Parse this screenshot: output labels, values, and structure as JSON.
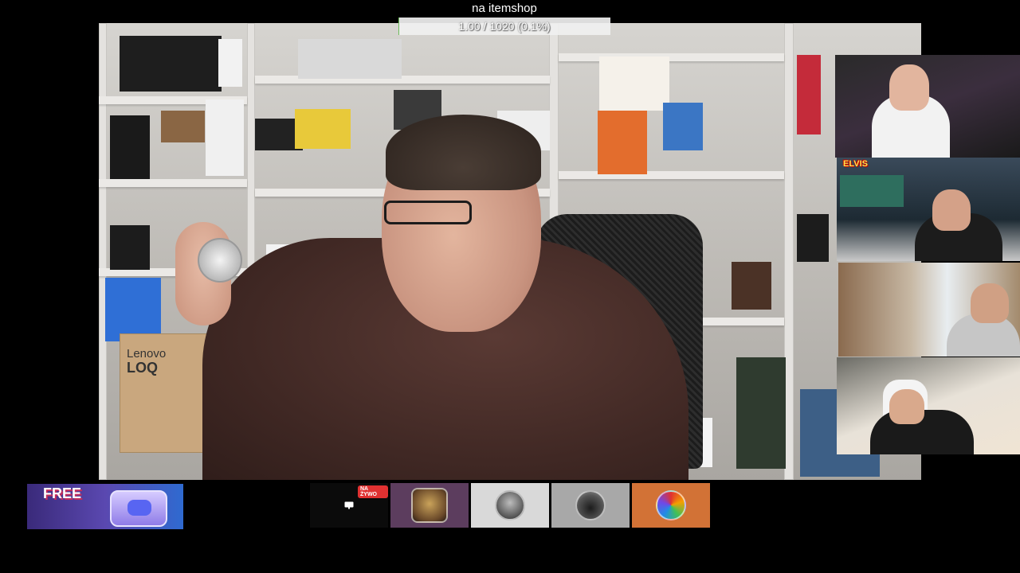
{
  "overlay": {
    "title": "na itemshop",
    "progress_text": "1.00 / 1020 (0.1%)",
    "progress_fraction": 0.001
  },
  "main_video": {
    "box_brand": "Lenovo",
    "box_model": "LOQ"
  },
  "side_cams": [
    {
      "name": "streamer-cam-1",
      "tag": ""
    },
    {
      "name": "streamer-cam-2",
      "tag": "ELVIS"
    },
    {
      "name": "streamer-cam-3",
      "tag": ""
    },
    {
      "name": "streamer-cam-4",
      "tag": ""
    }
  ],
  "banner": {
    "headline": "FREE"
  },
  "participants": [
    {
      "name": "participant-screen",
      "bg": "#0b0b0b",
      "live_label": "NA ŻYWO",
      "icon": "monitor-icon"
    },
    {
      "name": "participant-avatar-1",
      "bg": "#5c3d5e"
    },
    {
      "name": "participant-avatar-2",
      "bg": "#d9d9d9"
    },
    {
      "name": "participant-avatar-3",
      "bg": "#a8a8a8"
    },
    {
      "name": "participant-avatar-4",
      "bg": "#d27236"
    }
  ],
  "colors": {
    "progress_fill": "#6dbb5a",
    "live_badge": "#e03131"
  }
}
